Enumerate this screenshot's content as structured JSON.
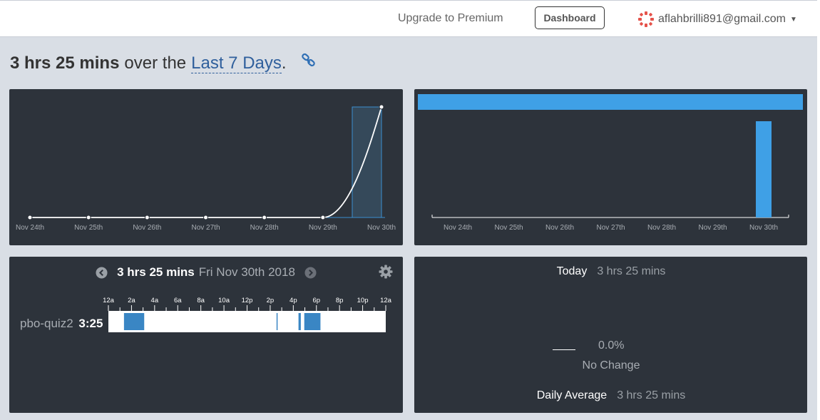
{
  "header": {
    "upgrade": "Upgrade to Premium",
    "dashboard": "Dashboard",
    "user_email": "aflahbrilli891@gmail.com"
  },
  "summary": {
    "duration": "3 hrs 25 mins",
    "over_the": "over the",
    "range": "Last 7 Days",
    "period": "."
  },
  "chart_data": [
    {
      "type": "line",
      "categories": [
        "Nov 24th",
        "Nov 25th",
        "Nov 26th",
        "Nov 27th",
        "Nov 28th",
        "Nov 29th",
        "Nov 30th"
      ],
      "series": [
        {
          "values": [
            0,
            0,
            0,
            0,
            0,
            0,
            3.42
          ]
        }
      ],
      "highlight_bar": {
        "category": "Nov 30th",
        "value": 3.42
      },
      "ylim": [
        0,
        3.42
      ]
    },
    {
      "type": "bar",
      "categories": [
        "Nov 24th",
        "Nov 25th",
        "Nov 26th",
        "Nov 27th",
        "Nov 28th",
        "Nov 29th",
        "Nov 30th"
      ],
      "values": [
        0,
        0,
        0,
        0,
        0,
        0,
        3.42
      ],
      "top_bar_value": 1.0,
      "color": "#3fa0e6"
    }
  ],
  "timeline": {
    "duration": "3 hrs 25 mins",
    "date": "Fri Nov 30th 2018",
    "ticks": [
      "12a",
      "2a",
      "4a",
      "6a",
      "8a",
      "10a",
      "12p",
      "2p",
      "4p",
      "6p",
      "8p",
      "10p",
      "12a"
    ],
    "project": {
      "name": "pbo-quiz2",
      "time": "3:25"
    },
    "sessions_hours": [
      [
        1.35,
        3.1
      ],
      [
        14.55,
        14.6
      ],
      [
        16.45,
        16.65
      ],
      [
        16.95,
        18.35
      ]
    ],
    "color": "#3a86c4"
  },
  "stats": {
    "today_label": "Today",
    "today_value": "3 hrs 25 mins",
    "percent": "0.0%",
    "change": "No Change",
    "avg_label": "Daily Average",
    "avg_value": "3 hrs 25 mins"
  },
  "icons": [
    "avatar-icon",
    "chevron-down-icon",
    "link-icon",
    "chevron-left-icon",
    "chevron-right-icon",
    "gear-icon"
  ]
}
